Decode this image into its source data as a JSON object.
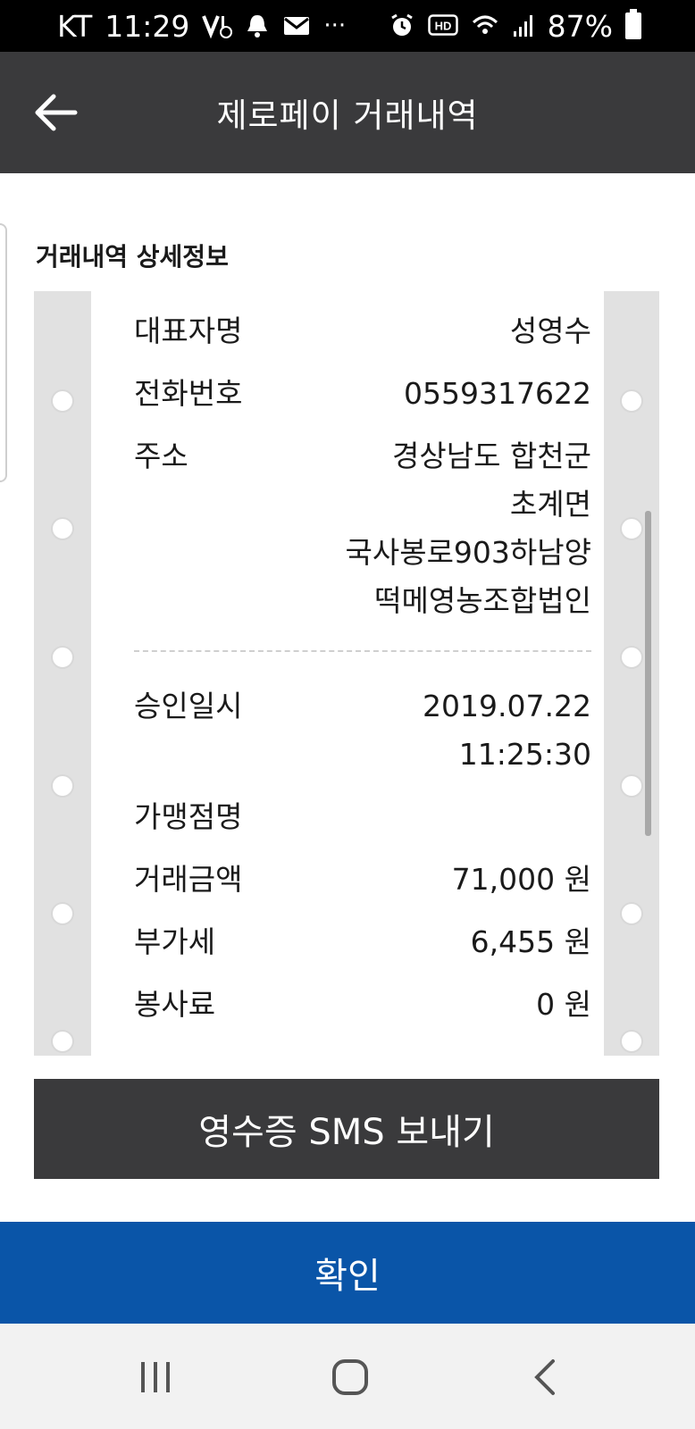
{
  "status_bar": {
    "carrier": "KT",
    "time": "11:29",
    "more": "···",
    "hd": "HD",
    "battery": "87%",
    "icons": [
      "volte-icon",
      "alarm-bell-icon",
      "mail-icon",
      "alarm-clock-icon",
      "hd-icon",
      "wifi-icon",
      "signal-icon",
      "battery-icon"
    ]
  },
  "header": {
    "title": "제로페이 거래내역",
    "back_icon": "arrow-left-icon"
  },
  "section_title": "거래내역 상세정보",
  "receipt": {
    "representative": {
      "label": "대표자명",
      "value": "성영수"
    },
    "phone": {
      "label": "전화번호",
      "value": "0559317622"
    },
    "address": {
      "label": "주소",
      "lines": [
        "경상남도 합천군",
        "초계면",
        "국사봉로903하남양",
        "떡메영농조합법인"
      ]
    },
    "approval": {
      "label": "승인일시",
      "date": "2019.07.22",
      "time": "11:25:30"
    },
    "merchant": {
      "label": "가맹점명",
      "value": ""
    },
    "amount": {
      "label": "거래금액",
      "value": "71,000 원"
    },
    "vat": {
      "label": "부가세",
      "value": "6,455 원"
    },
    "service_fee": {
      "label": "봉사료",
      "value": "0 원"
    }
  },
  "buttons": {
    "sms": "영수증 SMS 보내기",
    "confirm": "확인"
  },
  "nav": {
    "icons": [
      "recent-apps-icon",
      "home-icon",
      "back-icon"
    ]
  },
  "colors": {
    "header_bg": "#3a3a3c",
    "confirm_bg": "#0a55a8",
    "receipt_bg": "#e1e1e1"
  }
}
